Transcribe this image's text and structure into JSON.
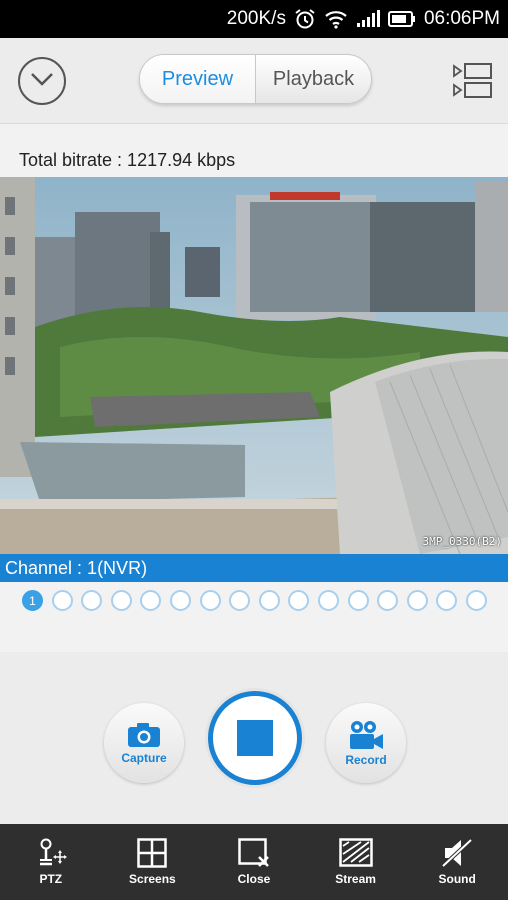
{
  "status_bar": {
    "speed": "200K/s",
    "time": "06:06PM",
    "icons": [
      "alarm-icon",
      "wifi-icon",
      "signal-icon",
      "battery-icon"
    ]
  },
  "header": {
    "tabs": [
      {
        "label": "Preview",
        "active": true
      },
      {
        "label": "Playback",
        "active": false
      }
    ],
    "icons": [
      "chevron-down-icon",
      "layout-icon"
    ]
  },
  "info": {
    "bitrate": "Total bitrate : 1217.94 kbps"
  },
  "video": {
    "camera_overlay": "3MP_0330(B2)"
  },
  "channel": {
    "label": "Channel : 1(NVR)",
    "pages": [
      "1",
      "",
      "",
      "",
      "",
      "",
      "",
      "",
      "",
      "",
      "",
      "",
      "",
      "",
      "",
      ""
    ],
    "active_page": 1
  },
  "controls": {
    "capture_label": "Capture",
    "record_label": "Record",
    "stop_icon": "stop-icon"
  },
  "toolbar": {
    "items": [
      {
        "label": "PTZ",
        "icon": "ptz-icon"
      },
      {
        "label": "Screens",
        "icon": "grid-icon"
      },
      {
        "label": "Close",
        "icon": "close-window-icon"
      },
      {
        "label": "Stream",
        "icon": "stream-icon"
      },
      {
        "label": "Sound",
        "icon": "sound-off-icon"
      }
    ]
  },
  "colors": {
    "accent": "#1a82d2",
    "channel_bar": "#1a82d2",
    "toolbar_bg": "#2f2f2f"
  }
}
